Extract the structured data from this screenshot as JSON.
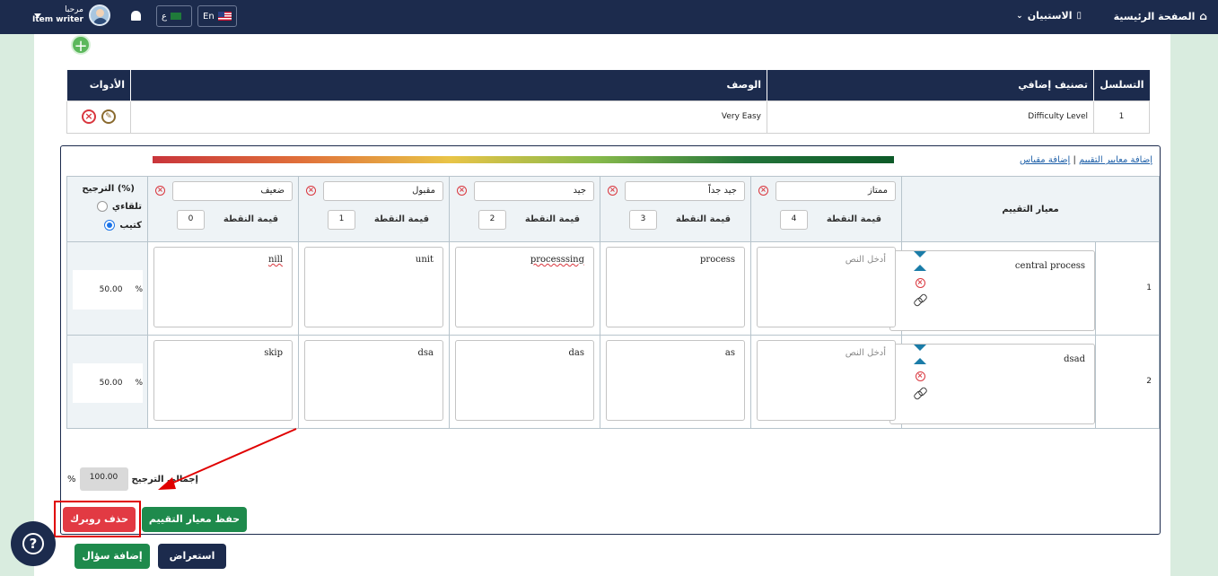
{
  "nav": {
    "home": "الصفحة الرئيسية",
    "exams": "الاستبيان",
    "greeting": "مرحبا",
    "user_name": "Item writer",
    "lang_en": "En",
    "lang_ar": "ع"
  },
  "classification_table": {
    "headers": {
      "serial": "التسلسل",
      "extra": "تصنيف إضافي",
      "desc": "الوصف",
      "tools": "الأدوات"
    },
    "rows": [
      {
        "serial": "1",
        "extra": "Difficulty Level",
        "desc": "Very Easy"
      }
    ]
  },
  "rubric": {
    "links": {
      "add_criteria": "إضافة معايير التقييم",
      "separator": "|",
      "add_scale": "إضافة مقياس"
    },
    "criteria_header": "معيار التقييم",
    "point_label": "قيمة النقطة",
    "levels": [
      {
        "name": "ممتاز",
        "points": "4"
      },
      {
        "name": "جيد جداً",
        "points": "3"
      },
      {
        "name": "جيد",
        "points": "2"
      },
      {
        "name": "مقبول",
        "points": "1"
      },
      {
        "name": "ضعيف",
        "points": "0"
      }
    ],
    "weight_header": "(%) الترجيح",
    "weight_options": {
      "auto": "تلقاءي",
      "written": "كتيب"
    },
    "rows": [
      {
        "num": "1",
        "criterion": "central process",
        "cells": [
          "أدخل النص",
          "process",
          "processsing",
          "unit",
          "nill"
        ],
        "weight": "50.00",
        "pct": "%"
      },
      {
        "num": "2",
        "criterion": "dsad",
        "cells": [
          "أدخل النص",
          "as",
          "das",
          "dsa",
          "skip"
        ],
        "weight": "50.00",
        "pct": "%"
      }
    ],
    "total_label": "إجمالي الترجيح",
    "total_value": "100.00",
    "total_pct": "%",
    "save_btn": "حفظ معيار التقييم",
    "delete_btn": "حذف روبرك"
  },
  "footer": {
    "preview_btn": "استعراض",
    "add_question_btn": "إضافة سؤال"
  },
  "colors": {
    "navy": "#1c2b4d",
    "green": "#1e8a4c",
    "red": "#e23a43",
    "annotation": "#e00000"
  },
  "icons": {
    "help": "help-icon",
    "add": "plus-circle-icon",
    "edit": "pencil-icon",
    "delete": "close-circle-icon"
  }
}
